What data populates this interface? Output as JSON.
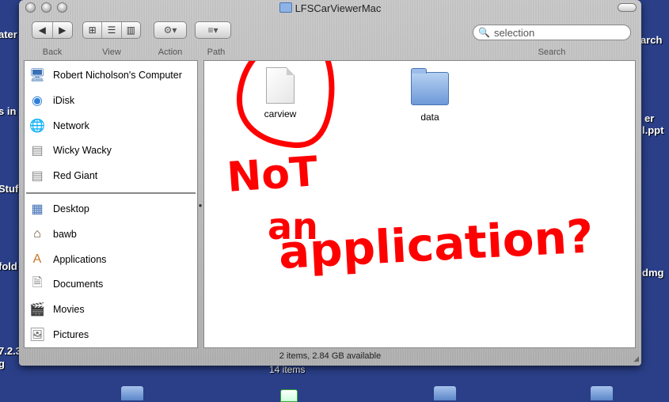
{
  "window": {
    "title": "LFSCarViewerMac"
  },
  "toolbar": {
    "back_label": "Back",
    "view_label": "View",
    "action_label": "Action",
    "path_label": "Path",
    "search_label": "Search",
    "search_value": "selection"
  },
  "sidebar": {
    "devices": [
      {
        "label": "Robert Nicholson's Computer",
        "icon": "computer-icon"
      },
      {
        "label": "iDisk",
        "icon": "idisk-icon"
      },
      {
        "label": "Network",
        "icon": "network-icon"
      },
      {
        "label": "Wicky Wacky",
        "icon": "hard-drive-icon"
      },
      {
        "label": "Red Giant",
        "icon": "hard-drive-icon"
      }
    ],
    "places": [
      {
        "label": "Desktop",
        "icon": "desktop-icon"
      },
      {
        "label": "bawb",
        "icon": "home-icon"
      },
      {
        "label": "Applications",
        "icon": "applications-icon"
      },
      {
        "label": "Documents",
        "icon": "documents-icon"
      },
      {
        "label": "Movies",
        "icon": "movies-icon"
      },
      {
        "label": "Pictures",
        "icon": "pictures-icon"
      }
    ]
  },
  "files": [
    {
      "name": "carview",
      "icon": "document-icon"
    },
    {
      "name": "data",
      "icon": "folder-icon"
    }
  ],
  "annotation": {
    "text_line1": "NoT",
    "text_line2": "an",
    "text_line3": "application?",
    "color": "#ff0000"
  },
  "status": {
    "text": "2 items, 2.84 GB available"
  },
  "desktop": {
    "labels": [
      "ater",
      "s in",
      "Stuf",
      "fold",
      "7.2.3",
      "g",
      "arch",
      "er",
      "l.ppt",
      "dmg",
      "14 items"
    ]
  }
}
